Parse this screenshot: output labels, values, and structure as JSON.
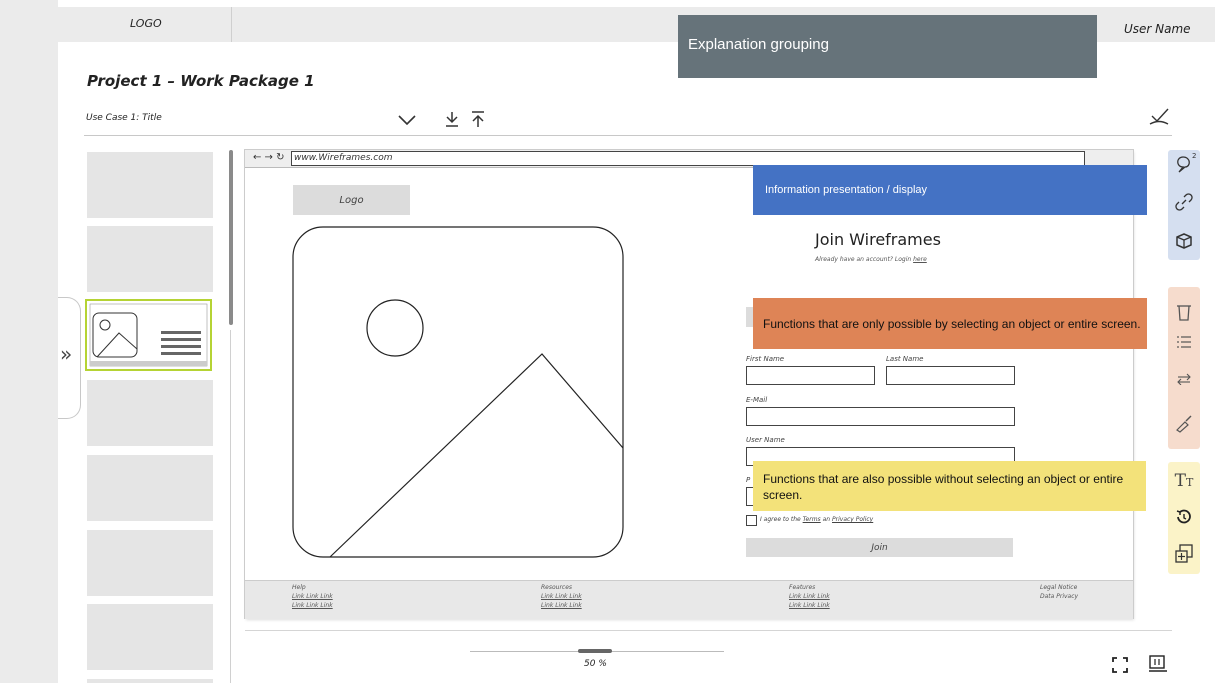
{
  "header": {
    "logo": "LOGO",
    "user_name": "User Name"
  },
  "project_title": "Project 1 – Work Package 1",
  "use_case": {
    "selected": "Use Case 1: Title"
  },
  "browser": {
    "address": "www.Wireframes.com"
  },
  "wireframe": {
    "logo": "Logo",
    "join_title": "Join Wireframes",
    "login_prompt": "Already have an account? Login",
    "login_link": "here",
    "fields": {
      "first_name": "First Name",
      "last_name": "Last Name",
      "email": "E-Mail",
      "user_name": "User Name",
      "password": "P"
    },
    "agree_prefix": "I agree to the",
    "terms": "Terms",
    "agree_and": "an",
    "privacy": "Privacy Policy",
    "join_button": "Join",
    "footer": {
      "help_title": "Help",
      "resources_title": "Resources",
      "features_title": "Features",
      "links_row": "Link Link Link",
      "legal_notice": "Legal Notice",
      "data_privacy": "Data Privacy"
    }
  },
  "zoom": "50 %",
  "notes": {
    "explanation_grouping": "Explanation grouping",
    "info_display": "Information presentation / display",
    "select_functions": "Functions that are only possible by selecting an object or entire screen.",
    "free_functions": "Functions that are also possible without selecting an object or entire screen."
  },
  "comment_count": "2",
  "colors": {
    "grouping_note": "#66737a",
    "info_note": "#4472c4",
    "select_note": "#de8456",
    "free_note": "#f3e27a",
    "thumb_highlight": "#b5d334"
  },
  "icons": {
    "toolbar": [
      "chevron-down-icon",
      "download-icon",
      "upload-icon",
      "approve-icon"
    ],
    "right_panel": [
      "comment-icon",
      "link-icon",
      "cube-icon",
      "trash-icon",
      "list-icon",
      "swap-icon",
      "paint-brush-icon",
      "text-size-icon",
      "history-icon",
      "group-icon"
    ],
    "bottom": [
      "fullscreen-icon",
      "presentation-icon"
    ],
    "left": "expand-sidebar-icon"
  }
}
